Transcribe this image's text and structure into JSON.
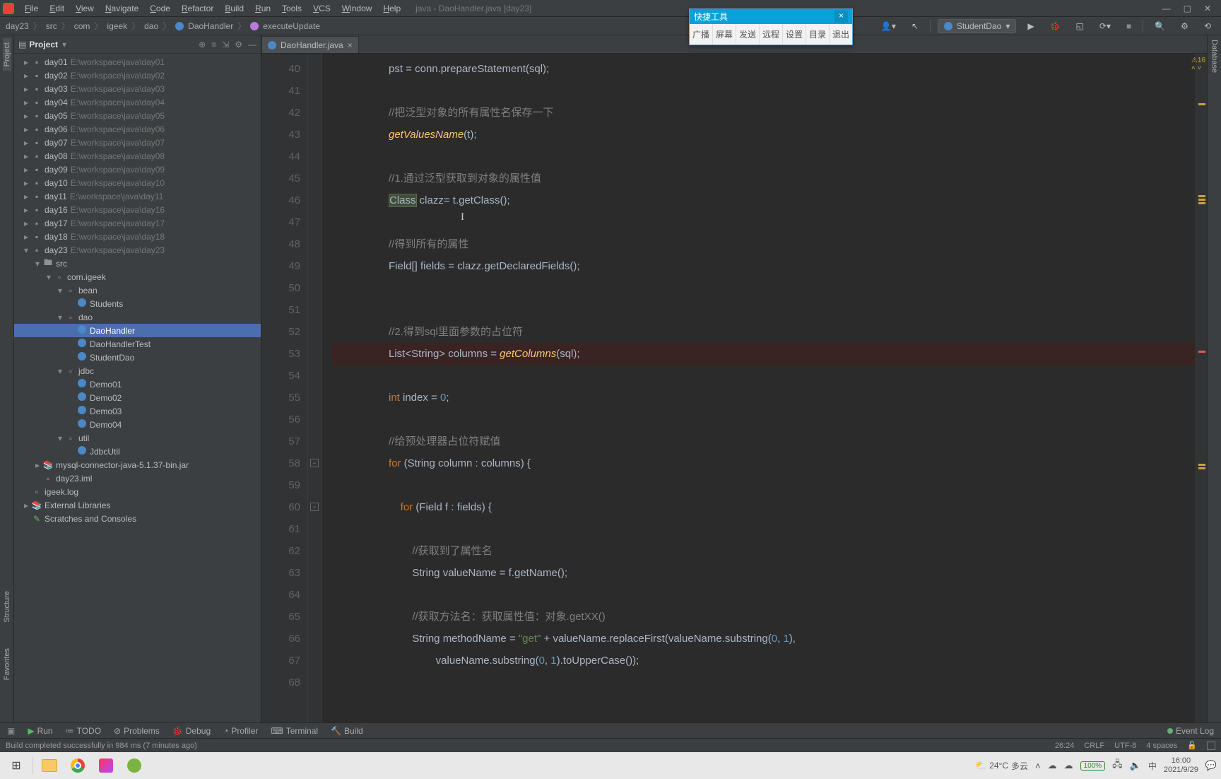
{
  "titlebar": {
    "menu": [
      "File",
      "Edit",
      "View",
      "Navigate",
      "Code",
      "Refactor",
      "Build",
      "Run",
      "Tools",
      "VCS",
      "Window",
      "Help"
    ],
    "title": "java - DaoHandler.java [day23]"
  },
  "quick_tool": {
    "title": "快捷工具",
    "items": [
      "广播",
      "屏幕",
      "发送",
      "远程",
      "设置",
      "目录",
      "退出"
    ]
  },
  "breadcrumbs": [
    "day23",
    "src",
    "com",
    "igeek",
    "dao",
    "DaoHandler",
    "executeUpdate"
  ],
  "run_config": "StudentDao",
  "project": {
    "title": "Project",
    "tree": [
      {
        "d": 0,
        "tw": "▸",
        "ic": "mod",
        "name": "day01",
        "dim": "E:\\workspace\\java\\day01"
      },
      {
        "d": 0,
        "tw": "▸",
        "ic": "mod",
        "name": "day02",
        "dim": "E:\\workspace\\java\\day02"
      },
      {
        "d": 0,
        "tw": "▸",
        "ic": "mod",
        "name": "day03",
        "dim": "E:\\workspace\\java\\day03"
      },
      {
        "d": 0,
        "tw": "▸",
        "ic": "mod",
        "name": "day04",
        "dim": "E:\\workspace\\java\\day04"
      },
      {
        "d": 0,
        "tw": "▸",
        "ic": "mod",
        "name": "day05",
        "dim": "E:\\workspace\\java\\day05"
      },
      {
        "d": 0,
        "tw": "▸",
        "ic": "mod",
        "name": "day06",
        "dim": "E:\\workspace\\java\\day06"
      },
      {
        "d": 0,
        "tw": "▸",
        "ic": "mod",
        "name": "day07",
        "dim": "E:\\workspace\\java\\day07"
      },
      {
        "d": 0,
        "tw": "▸",
        "ic": "mod",
        "name": "day08",
        "dim": "E:\\workspace\\java\\day08"
      },
      {
        "d": 0,
        "tw": "▸",
        "ic": "mod",
        "name": "day09",
        "dim": "E:\\workspace\\java\\day09"
      },
      {
        "d": 0,
        "tw": "▸",
        "ic": "mod",
        "name": "day10",
        "dim": "E:\\workspace\\java\\day10"
      },
      {
        "d": 0,
        "tw": "▸",
        "ic": "mod",
        "name": "day11",
        "dim": "E:\\workspace\\java\\day11"
      },
      {
        "d": 0,
        "tw": "▸",
        "ic": "mod",
        "name": "day16",
        "dim": "E:\\workspace\\java\\day16"
      },
      {
        "d": 0,
        "tw": "▸",
        "ic": "mod",
        "name": "day17",
        "dim": "E:\\workspace\\java\\day17"
      },
      {
        "d": 0,
        "tw": "▸",
        "ic": "mod",
        "name": "day18",
        "dim": "E:\\workspace\\java\\day18"
      },
      {
        "d": 0,
        "tw": "▾",
        "ic": "mod",
        "name": "day23",
        "dim": "E:\\workspace\\java\\day23"
      },
      {
        "d": 1,
        "tw": "▾",
        "ic": "folder",
        "name": "src"
      },
      {
        "d": 2,
        "tw": "▾",
        "ic": "pkg",
        "name": "com.igeek"
      },
      {
        "d": 3,
        "tw": "▾",
        "ic": "pkg",
        "name": "bean"
      },
      {
        "d": 4,
        "tw": "",
        "ic": "class",
        "name": "Students"
      },
      {
        "d": 3,
        "tw": "▾",
        "ic": "pkg",
        "name": "dao"
      },
      {
        "d": 4,
        "tw": "",
        "ic": "class",
        "name": "DaoHandler",
        "sel": true
      },
      {
        "d": 4,
        "tw": "",
        "ic": "class",
        "name": "DaoHandlerTest"
      },
      {
        "d": 4,
        "tw": "",
        "ic": "class",
        "name": "StudentDao"
      },
      {
        "d": 3,
        "tw": "▾",
        "ic": "pkg",
        "name": "jdbc"
      },
      {
        "d": 4,
        "tw": "",
        "ic": "class",
        "name": "Demo01"
      },
      {
        "d": 4,
        "tw": "",
        "ic": "class",
        "name": "Demo02"
      },
      {
        "d": 4,
        "tw": "",
        "ic": "class",
        "name": "Demo03"
      },
      {
        "d": 4,
        "tw": "",
        "ic": "class",
        "name": "Demo04"
      },
      {
        "d": 3,
        "tw": "▾",
        "ic": "pkg",
        "name": "util"
      },
      {
        "d": 4,
        "tw": "",
        "ic": "class",
        "name": "JdbcUtil"
      },
      {
        "d": 1,
        "tw": "▸",
        "ic": "lib",
        "name": "mysql-connector-java-5.1.37-bin.jar"
      },
      {
        "d": 1,
        "tw": "",
        "ic": "file",
        "name": "day23.iml"
      },
      {
        "d": 0,
        "tw": "",
        "ic": "file",
        "name": "igeek.log"
      },
      {
        "d": -1,
        "tw": "▸",
        "ic": "lib",
        "name": "External Libraries"
      },
      {
        "d": -1,
        "tw": "",
        "ic": "scratch",
        "name": "Scratches and Consoles"
      }
    ]
  },
  "tab": {
    "label": "DaoHandler.java"
  },
  "code": {
    "first_line": 40,
    "lines": [
      {
        "n": 40,
        "html": "pst = <span class='id'>conn</span>.prepareStatement(sql);"
      },
      {
        "n": 41,
        "html": ""
      },
      {
        "n": 42,
        "html": "<span class='cm'>//把泛型对象的所有属性名保存一下</span>"
      },
      {
        "n": 43,
        "html": "<span class='fni'>getValuesName</span>(t);"
      },
      {
        "n": 44,
        "html": ""
      },
      {
        "n": 45,
        "html": "<span class='cm'>//1.通过泛型获取到对象的属性值</span>"
      },
      {
        "n": 46,
        "html": "<span class='box-hl'>Class</span> clazz<span class='cursor-mark'> </span>= t.getClass();"
      },
      {
        "n": 47,
        "html": ""
      },
      {
        "n": 48,
        "html": "<span class='cm'>//得到所有的属性</span>"
      },
      {
        "n": 49,
        "html": "Field[] fields = clazz.getDeclaredFields();"
      },
      {
        "n": 50,
        "html": ""
      },
      {
        "n": 51,
        "html": ""
      },
      {
        "n": 52,
        "html": "<span class='cm'>//2.得到sql里面参数的占位符</span>"
      },
      {
        "n": 53,
        "html": "List&lt;String&gt; columns = <span class='fni'>getColumns</span>(sql);",
        "bp": true,
        "hl": true
      },
      {
        "n": 54,
        "html": ""
      },
      {
        "n": 55,
        "html": "<span class='kw'>int</span> index = <span class='num'>0</span>;"
      },
      {
        "n": 56,
        "html": ""
      },
      {
        "n": 57,
        "html": "<span class='cm'>//给预处理器占位符赋值</span>"
      },
      {
        "n": 58,
        "html": "<span class='kw'>for</span> (String column : columns) {"
      },
      {
        "n": 59,
        "html": ""
      },
      {
        "n": 60,
        "html": "    <span class='kw'>for</span> (Field f : fields) {"
      },
      {
        "n": 61,
        "html": ""
      },
      {
        "n": 62,
        "html": "        <span class='cm'>//获取到了属性名</span>"
      },
      {
        "n": 63,
        "html": "        String valueName = f.getName();"
      },
      {
        "n": 64,
        "html": ""
      },
      {
        "n": 65,
        "html": "        <span class='cm'>//获取方法名：获取属性值：对象.getXX()</span>"
      },
      {
        "n": 66,
        "html": "        String methodName = <span class='str'>\"get\"</span> + valueName.replaceFirst(valueName.substring(<span class='num'>0</span>, <span class='num'>1</span>),"
      },
      {
        "n": 67,
        "html": "                valueName.substring(<span class='num'>0</span>, <span class='num'>1</span>).toUpperCase());"
      },
      {
        "n": 68,
        "html": ""
      }
    ]
  },
  "inspection": {
    "warnings": "16"
  },
  "left_rail": [
    "Project",
    "Structure",
    "Favorites"
  ],
  "right_rail": "Database",
  "bottom_tools": [
    "Run",
    "TODO",
    "Problems",
    "Debug",
    "Profiler",
    "Terminal",
    "Build"
  ],
  "event_log": "Event Log",
  "status": {
    "msg": "Build completed successfully in 984 ms (7 minutes ago)",
    "pos": "26:24",
    "eol": "CRLF",
    "enc": "UTF-8",
    "indent": "4 spaces"
  },
  "taskbar": {
    "weather_temp": "24°C",
    "weather_desc": "多云",
    "battery": "100%",
    "ime": "中",
    "time": "16:00",
    "date": "2021/9/29"
  }
}
